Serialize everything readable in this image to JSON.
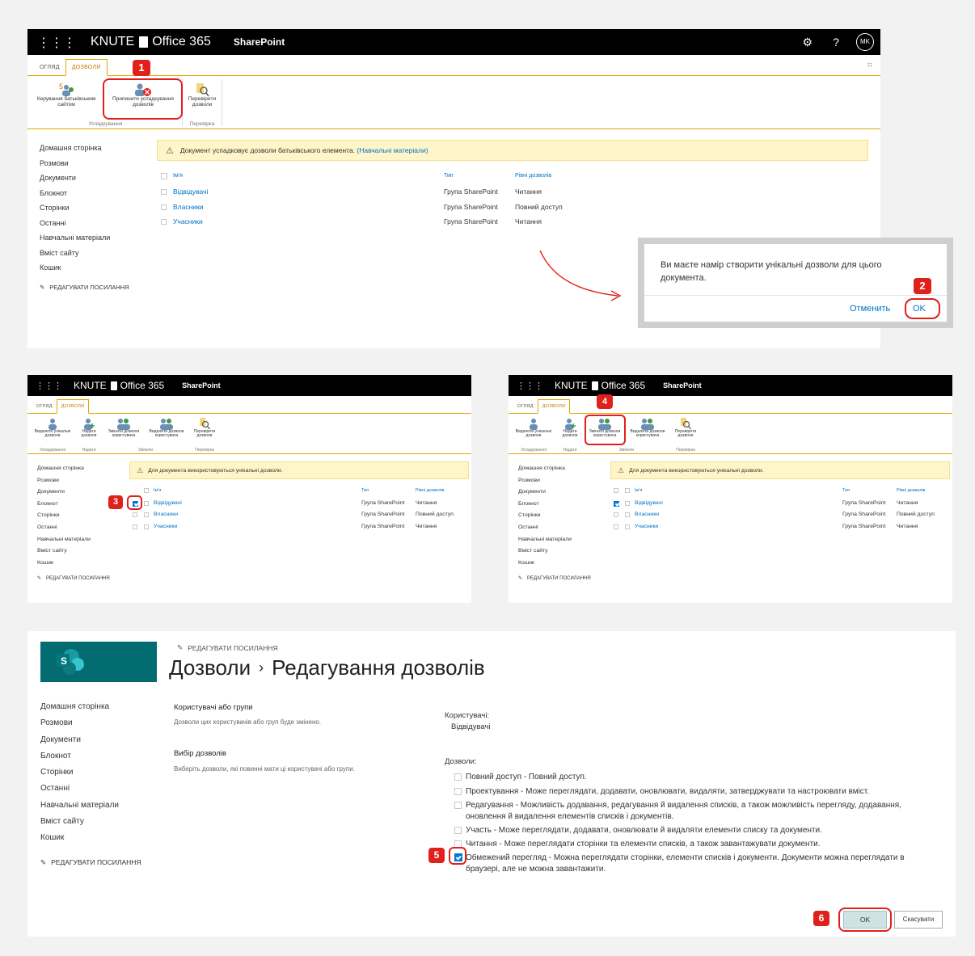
{
  "topbar": {
    "brand": "KNUTE",
    "product": "Office 365",
    "app": "SharePoint",
    "help": "?",
    "avatar": "MK"
  },
  "tabs": {
    "overview": "ОГЛЯД",
    "permissions": "ДОЗВОЛИ"
  },
  "ribbon1": {
    "manage_parent": "Керування батьківським сайтом",
    "stop_inherit": "Припинити успадкування дозволів",
    "check": "Перевірити дозволи",
    "group_inherit": "Успадкування",
    "group_check": "Перевірка"
  },
  "ribbon2": {
    "delete_unique": "Видалити унікальні дозволи",
    "grant": "Надати дозволи",
    "edit_user": "Змінити дозволи користувача",
    "remove_user": "Видалити дозволи користувача",
    "check": "Перевірити дозволи",
    "group_inherit": "Успадкування",
    "group_grant": "Надати",
    "group_modify": "Змінити",
    "group_check": "Перевірка"
  },
  "nav": [
    "Домашня сторінка",
    "Розмови",
    "Документи",
    "Блокнот",
    "Сторінки",
    "Останні",
    "Навчальні матеріали",
    "Вміст сайту",
    "Кошик"
  ],
  "edit_links": "РЕДАГУВАТИ ПОСИЛАННЯ",
  "banner1": {
    "text": "Документ успадковує дозволи батьківського елемента.",
    "link": "(Навчальні матеріали)"
  },
  "banner2": {
    "text": "Для документа використовуються унікальні дозволи."
  },
  "table": {
    "headers": {
      "name": "Ім'я",
      "type": "Тип",
      "level": "Рівні дозволів"
    },
    "rows": [
      {
        "name": "Відвідувачі",
        "type": "Група SharePoint",
        "level": "Читання"
      },
      {
        "name": "Власники",
        "type": "Група SharePoint",
        "level": "Повний доступ"
      },
      {
        "name": "Учасники",
        "type": "Група SharePoint",
        "level": "Читання"
      }
    ]
  },
  "dialog": {
    "message": "Ви маєте намір створити унікальні дозволи для цього документа.",
    "cancel": "Отменить",
    "ok": "OK"
  },
  "steps": [
    "1",
    "2",
    "3",
    "4",
    "5",
    "6"
  ],
  "edit_page": {
    "title": "Дозволи",
    "separator": "›",
    "subtitle": "Редагування дозволів",
    "logo_letter": "S",
    "users_groups_title": "Користувачі або групи",
    "users_groups_desc": "Дозволи цих користувачів або груп буде змінено.",
    "choose_title": "Вибір дозволів",
    "choose_desc": "Виберіть дозволи, які повинні мати ці користувачі або групи.",
    "users_label": "Користувачі:",
    "users_value": "Відвідувачі",
    "perms_label": "Дозволи:",
    "permissions": [
      {
        "text": "Повний доступ - Повний доступ.",
        "checked": false
      },
      {
        "text": "Проектування - Може переглядати, додавати, оновлювати, видаляти, затверджувати та настроювати вміст.",
        "checked": false
      },
      {
        "text": "Редагування - Можливість додавання, редагування й видалення списків, а також можливість перегляду, додавання, оновлення й видалення елементів списків і документів.",
        "checked": false
      },
      {
        "text": "Участь - Може переглядати, додавати, оновлювати й видаляти елементи списку та документи.",
        "checked": false
      },
      {
        "text": "Читання - Може переглядати сторінки та елементи списків, а також завантажувати документи.",
        "checked": false
      },
      {
        "text": "Обмежений перегляд - Можна переглядати сторінки, елементи списків і документи. Документи можна переглядати в браузері, але не можна завантажити.",
        "checked": true
      }
    ],
    "ok": "OK",
    "cancel": "Скасувати"
  },
  "colors": {
    "accent": "#e0a800",
    "link": "#0072c6",
    "badge": "#e0201b",
    "teal": "#036c70"
  }
}
